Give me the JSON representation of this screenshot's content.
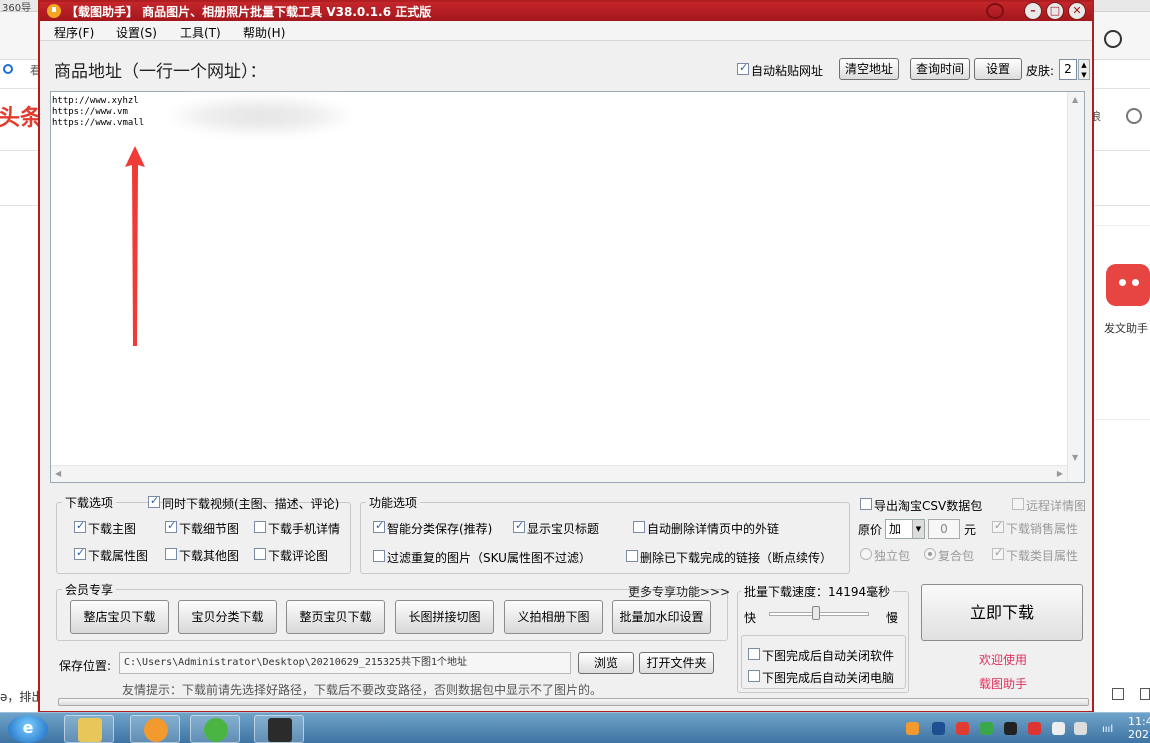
{
  "background": {
    "top_number": "360导",
    "red_headline": "头条",
    "left_char": "看",
    "bottom_text": "ə，排出",
    "right_char": "浪",
    "right_panel_label": "发文助手"
  },
  "window": {
    "title": "【载图助手】 商品图片、相册照片批量下载工具 V38.0.1.6 正式版",
    "min_glyph": "–",
    "max_glyph": "□",
    "close_glyph": "✕"
  },
  "menu": [
    {
      "label": "程序(F)"
    },
    {
      "label": "设置(S)"
    },
    {
      "label": "工具(T)"
    },
    {
      "label": "帮助(H)"
    }
  ],
  "top": {
    "url_label": "商品地址（一行一个网址）：",
    "auto_paste_label": "自动粘贴网址",
    "auto_paste_checked": true,
    "clear_label": "清空地址",
    "query_time_label": "查询时间",
    "settings_label": "设置",
    "skin_label": "皮肤:",
    "skin_value": "2"
  },
  "urls": [
    "http://www.xyhzl",
    "https://www.vm",
    "https://www.vmall"
  ],
  "download_options": {
    "title": "下载选项",
    "items": [
      {
        "label": "同时下载视频(主图、描述、评论)",
        "checked": true
      },
      {
        "label": "下载主图",
        "checked": true
      },
      {
        "label": "下载细节图",
        "checked": true
      },
      {
        "label": "下载手机详情",
        "checked": false
      },
      {
        "label": "下载属性图",
        "checked": true
      },
      {
        "label": "下载其他图",
        "checked": false
      },
      {
        "label": "下载评论图",
        "checked": false
      }
    ]
  },
  "function_options": {
    "title": "功能选项",
    "items": [
      {
        "label": "智能分类保存(推荐)",
        "checked": true
      },
      {
        "label": "显示宝贝标题",
        "checked": true
      },
      {
        "label": "自动删除详情页中的外链",
        "checked": false
      },
      {
        "label": "过滤重复的图片（SKU属性图不过滤）",
        "checked": false
      },
      {
        "label": "删除已下载完成的链接（断点续传）",
        "checked": false
      }
    ]
  },
  "export_csv": {
    "label": "导出淘宝CSV数据包",
    "checked": false,
    "remote_detail": "远程详情图",
    "price_label": "原价",
    "price_op": "加",
    "price_value": "0",
    "unit": "元",
    "sales_attr": "下载销售属性",
    "independent": "独立包",
    "combined": "复合包",
    "category_attr": "下载类目属性"
  },
  "vip": {
    "title": "会员专享",
    "more_label": "更多专享功能>>>",
    "buttons": [
      {
        "label": "整店宝贝下载"
      },
      {
        "label": "宝贝分类下载"
      },
      {
        "label": "整页宝贝下载"
      },
      {
        "label": "长图拼接切图"
      },
      {
        "label": "义拍相册下图"
      },
      {
        "label": "批量加水印设置"
      }
    ]
  },
  "speed": {
    "title": "批量下载速度：14194毫秒",
    "fast": "快",
    "slow": "慢",
    "level": 0.45,
    "close_software": "下图完成后自动关闭软件",
    "close_computer": "下图完成后自动关闭电脑"
  },
  "actions": {
    "download_now": "立即下载",
    "welcome": "欢迎使用",
    "app_name": "载图助手"
  },
  "save": {
    "label": "保存位置:",
    "path": "C:\\Users\\Administrator\\Desktop\\20210629_215325共下图1个地址",
    "browse": "浏览",
    "open_folder": "打开文件夹",
    "tip": "友情提示：下载前请先选择好路径，下载后不要改变路径，否则数据包中显示不了图片的。"
  },
  "taskbar": {
    "tray_label": "ıııl",
    "clock_time": "11:4",
    "clock_date": "202"
  },
  "colors": {
    "title_bar": "#b11e22",
    "welcome_text": "#e0305d",
    "arrow": "#f03a36",
    "checkbox_mark": "#2d5fb0"
  }
}
